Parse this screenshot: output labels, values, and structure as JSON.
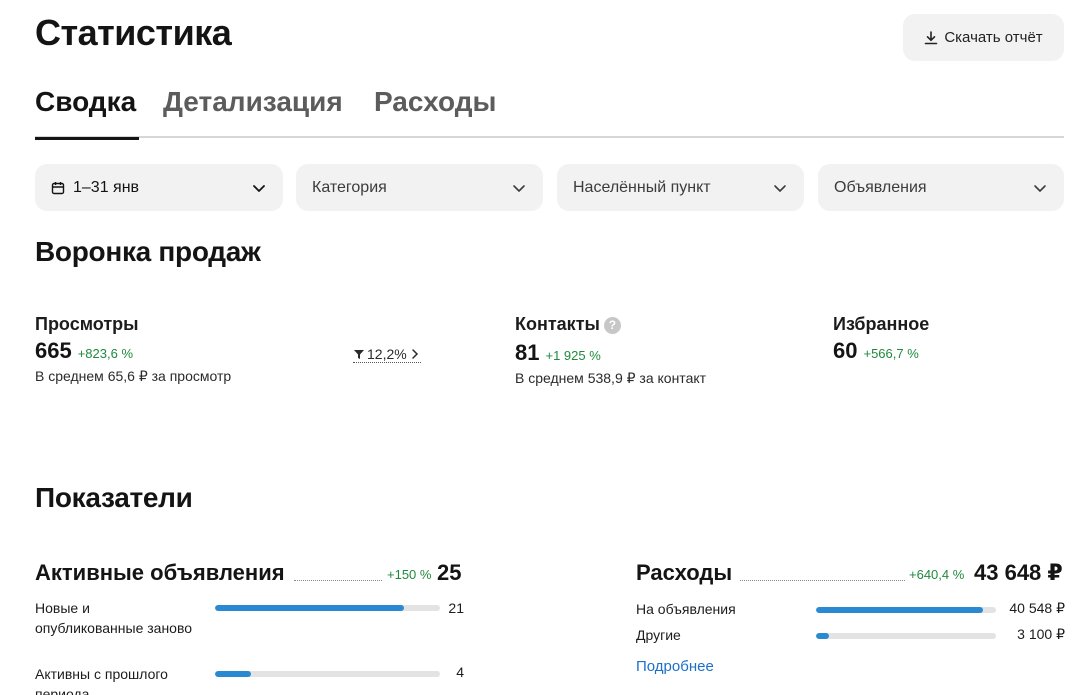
{
  "header": {
    "title": "Статистика",
    "download_label": "Скачать отчёт"
  },
  "tabs": [
    {
      "label": "Сводка",
      "active": true
    },
    {
      "label": "Детализация",
      "active": false
    },
    {
      "label": "Расходы",
      "active": false
    }
  ],
  "filters": {
    "date": "1–31 янв",
    "category": "Категория",
    "location": "Населённый пункт",
    "ads": "Объявления"
  },
  "funnel": {
    "title": "Воронка продаж",
    "views": {
      "label": "Просмотры",
      "value": "665",
      "delta": "+823,6 %",
      "sub": "В среднем 65,6 ₽ за просмотр"
    },
    "conversion": "12,2%",
    "contacts": {
      "label": "Контакты",
      "help": "?",
      "value": "81",
      "delta": "+1 925 %",
      "sub": "В среднем 538,9 ₽ за контакт"
    },
    "favorites": {
      "label": "Избранное",
      "value": "60",
      "delta": "+566,7 %"
    }
  },
  "indicators": {
    "title": "Показатели",
    "active_ads": {
      "title": "Активные объявления",
      "delta": "+150 %",
      "value": "25",
      "rows": [
        {
          "label": "Новые и опубликованные заново",
          "value": "21",
          "fill": 0.84
        },
        {
          "label": "Активны с прошлого периода",
          "value": "4",
          "fill": 0.16
        }
      ]
    },
    "expenses": {
      "title": "Расходы",
      "delta": "+640,4 %",
      "value": "43 648 ₽",
      "rows": [
        {
          "label": "На объявления",
          "value": "40 548 ₽",
          "fill": 0.93
        },
        {
          "label": "Другие",
          "value": "3 100 ₽",
          "fill": 0.07
        }
      ],
      "more_label": "Подробнее"
    }
  },
  "colors": {
    "accent": "#2a8ad1",
    "positive": "#1f8a3c",
    "link": "#1c70c9"
  }
}
